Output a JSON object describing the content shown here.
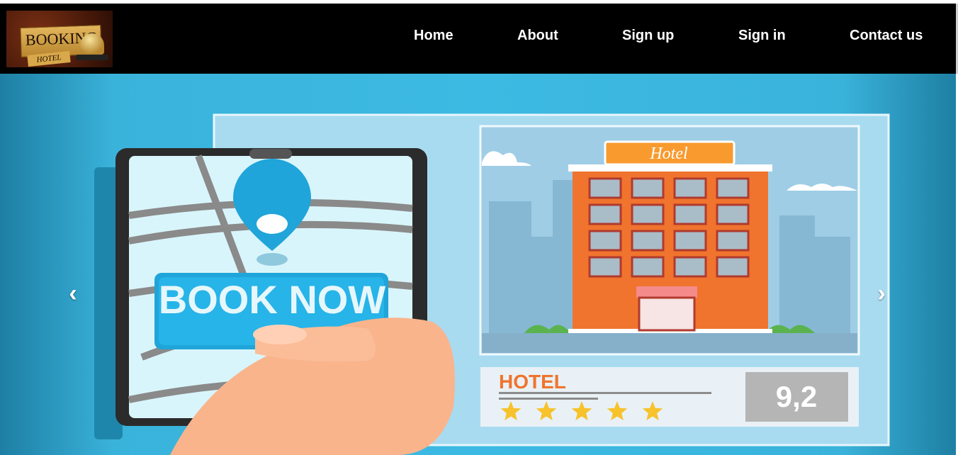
{
  "logo": {
    "title": "BOOKING",
    "subtitle": "HOTEL"
  },
  "nav": {
    "items": [
      {
        "label": "Home"
      },
      {
        "label": "About"
      },
      {
        "label": "Sign up"
      },
      {
        "label": "Sign in"
      },
      {
        "label": "Contact us"
      }
    ]
  },
  "carousel": {
    "prev_icon": "chevron-left-icon",
    "next_icon": "chevron-right-icon",
    "slide": {
      "phone_button_text": "BOOK NOW",
      "hotel_sign": "Hotel",
      "card_title": "HOTEL",
      "rating": "9,2",
      "stars": 5
    }
  },
  "colors": {
    "navbar": "#000000",
    "slide_bg": "#3cbae3",
    "hotel_orange": "#f0742e",
    "star_yellow": "#f7c22c"
  }
}
